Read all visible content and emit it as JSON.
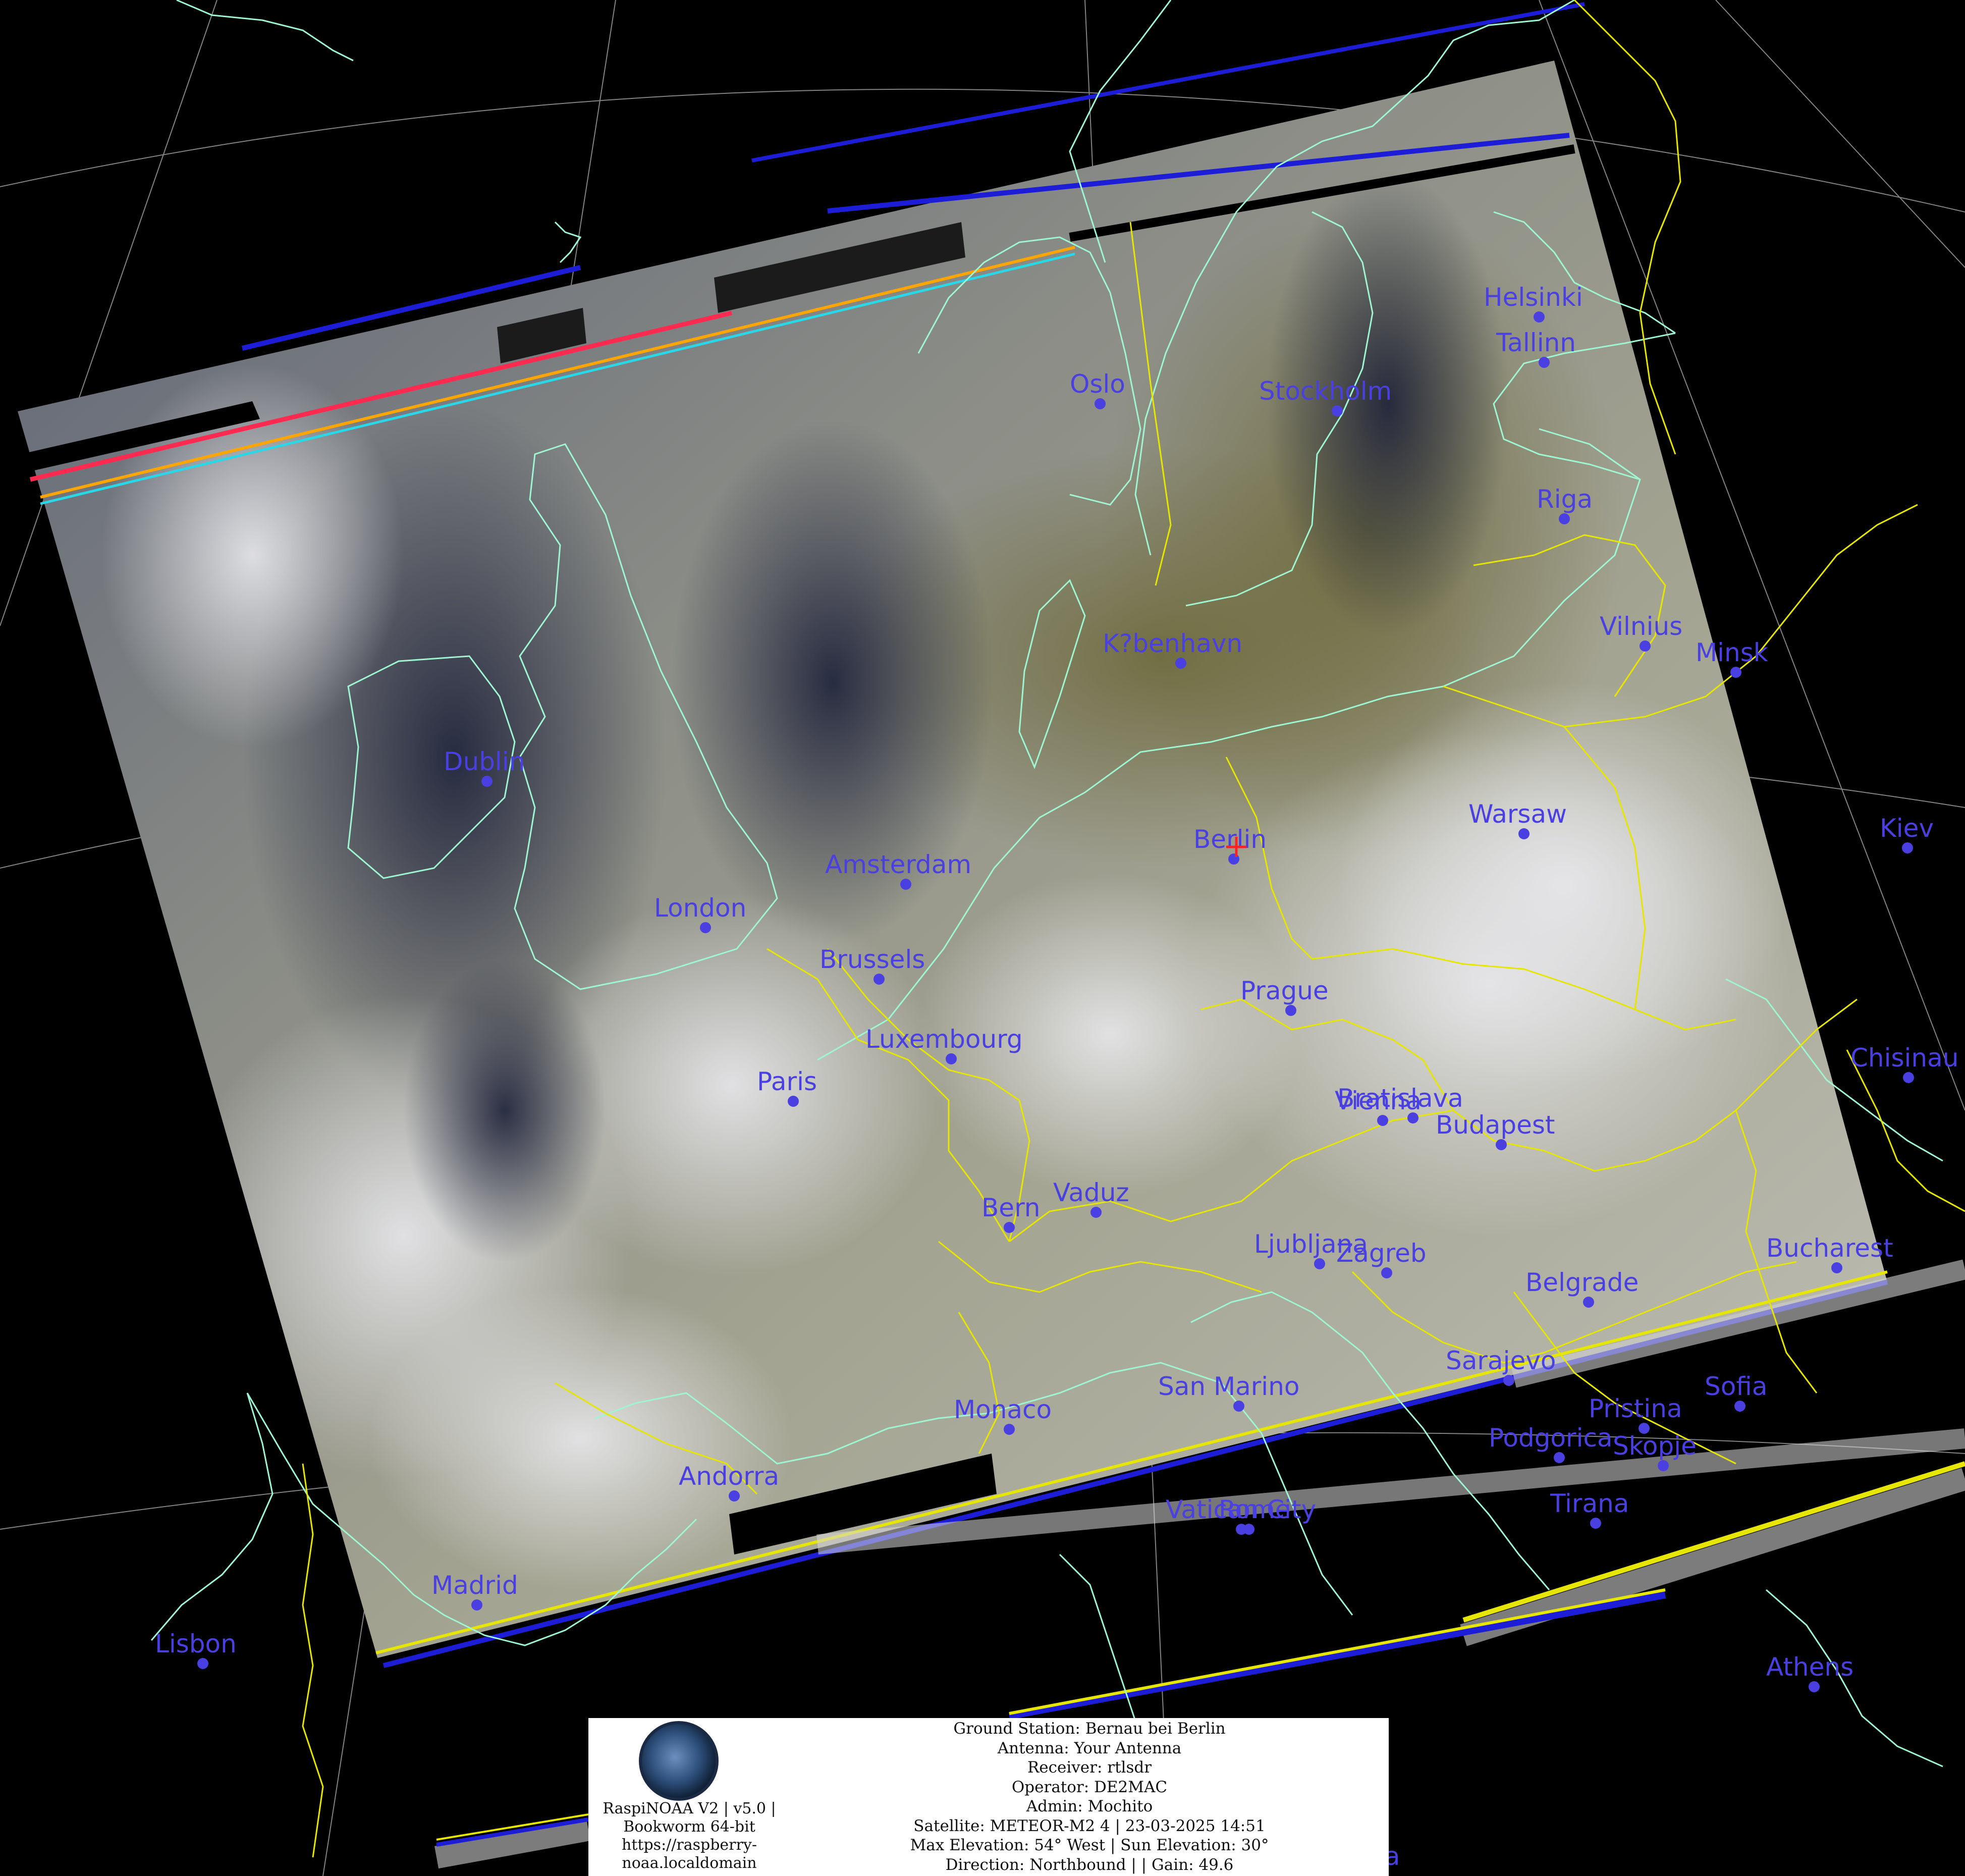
{
  "cities": [
    {
      "name": "Helsinki"
    },
    {
      "name": "Tallinn"
    },
    {
      "name": "Oslo"
    },
    {
      "name": "Stockholm"
    },
    {
      "name": "Riga"
    },
    {
      "name": "Vilnius"
    },
    {
      "name": "Minsk"
    },
    {
      "name": "K?benhavn"
    },
    {
      "name": "Dublin"
    },
    {
      "name": "Berlin"
    },
    {
      "name": "Warsaw"
    },
    {
      "name": "Kiev"
    },
    {
      "name": "Amsterdam"
    },
    {
      "name": "London"
    },
    {
      "name": "Brussels"
    },
    {
      "name": "Prague"
    },
    {
      "name": "Luxembourg"
    },
    {
      "name": "Paris"
    },
    {
      "name": "Chisinau"
    },
    {
      "name": "Vienna"
    },
    {
      "name": "Bratislava"
    },
    {
      "name": "Budapest"
    },
    {
      "name": "Bern"
    },
    {
      "name": "Vaduz"
    },
    {
      "name": "Ljubljana"
    },
    {
      "name": "Zagreb"
    },
    {
      "name": "Bucharest"
    },
    {
      "name": "Belgrade"
    },
    {
      "name": "Sarajevo"
    },
    {
      "name": "Sofia"
    },
    {
      "name": "Pristina"
    },
    {
      "name": "Monaco"
    },
    {
      "name": "San Marino"
    },
    {
      "name": "Podgorica"
    },
    {
      "name": "Skopje"
    },
    {
      "name": "Andorra"
    },
    {
      "name": "Vatican City"
    },
    {
      "name": "Rome"
    },
    {
      "name": "Tirana"
    },
    {
      "name": "Madrid"
    },
    {
      "name": "Lisbon"
    },
    {
      "name": "Athens"
    },
    {
      "name": "Valletta"
    }
  ],
  "ground_station_marker": "red-cross-marker",
  "info": {
    "logo_lines": [
      "RaspiNOAA V2 | v5.0 |",
      "Bookworm 64-bit",
      "https://raspberry-",
      "noaa.localdomain"
    ],
    "station_lines": [
      "Ground Station: Bernau bei Berlin",
      "Antenna: Your Antenna",
      "Receiver: rtlsdr",
      "Operator: DE2MAC",
      "Admin: Mochito",
      "Satellite: METEOR-M2 4 | 23-03-2025 14:51",
      "Max Elevation: 54° West | Sun Elevation: 30°",
      "Direction: Northbound | | Gain: 49.6"
    ]
  },
  "colors": {
    "city_label": "#4a3fe0",
    "coastline": "#9ef5d2",
    "border": "#e6e600",
    "graticule": "#bbbbbb"
  }
}
